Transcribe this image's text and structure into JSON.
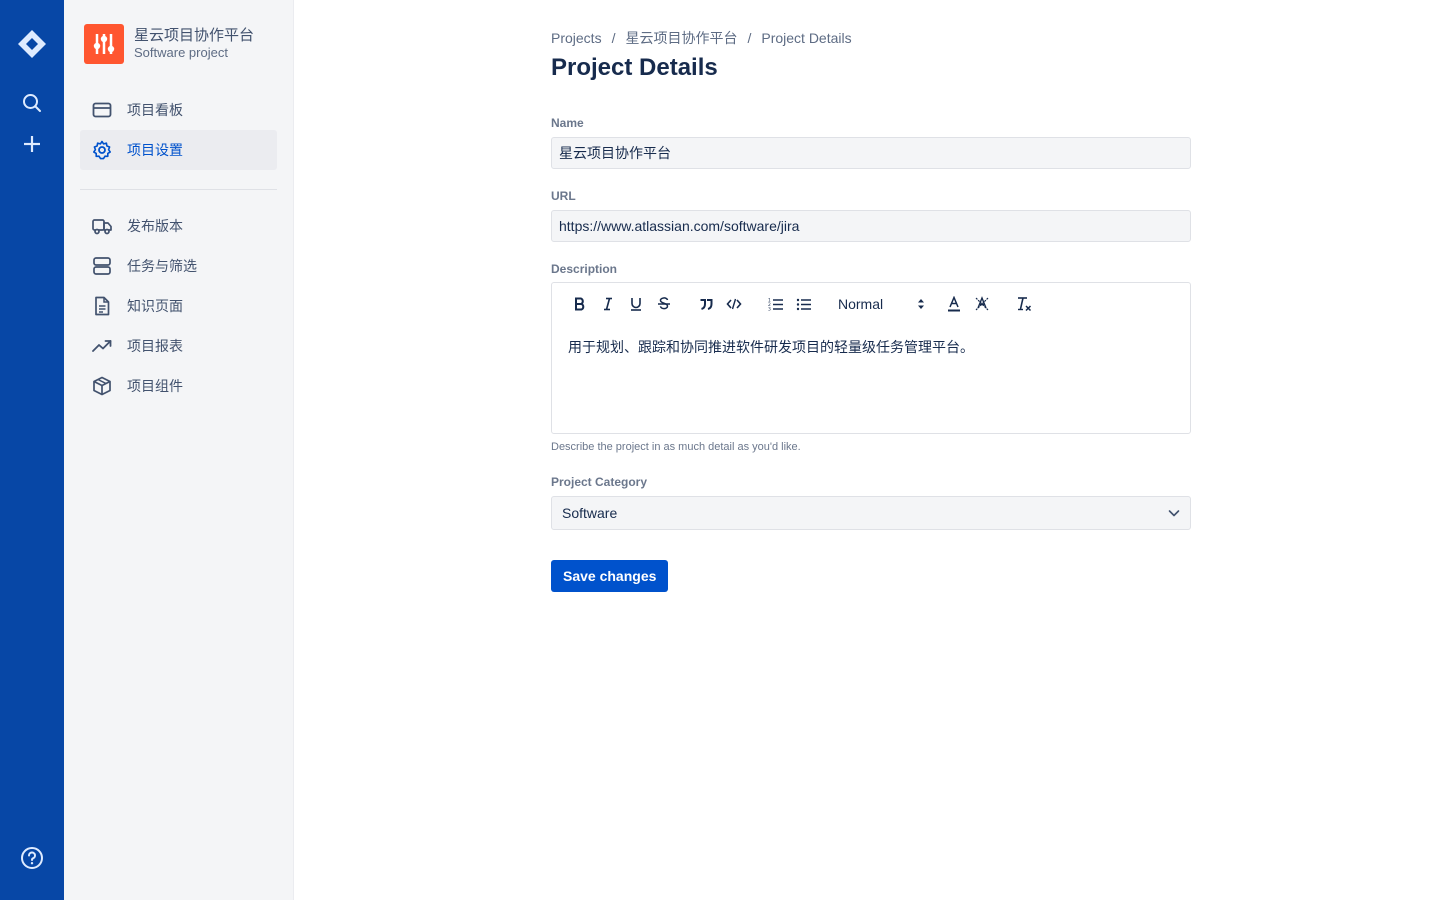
{
  "rail": {
    "icons": [
      "jira-logo-icon",
      "search-icon",
      "plus-icon",
      "help-icon"
    ],
    "color": "#0747a6"
  },
  "project": {
    "name": "星云项目协作平台",
    "type": "Software project",
    "avatar_color": "#ff5630"
  },
  "sidebar": {
    "primary": [
      {
        "label": "项目看板",
        "icon": "board-icon",
        "active": false
      },
      {
        "label": "项目设置",
        "icon": "gear-icon",
        "active": true
      }
    ],
    "secondary": [
      {
        "label": "发布版本",
        "icon": "truck-icon"
      },
      {
        "label": "任务与筛选",
        "icon": "server-icon"
      },
      {
        "label": "知识页面",
        "icon": "document-icon"
      },
      {
        "label": "项目报表",
        "icon": "trending-icon"
      },
      {
        "label": "项目组件",
        "icon": "package-icon"
      }
    ]
  },
  "breadcrumbs": [
    "Projects",
    "星云项目协作平台",
    "Project Details"
  ],
  "page": {
    "title": "Project Details"
  },
  "form": {
    "name_label": "Name",
    "name_value": "星云项目协作平台",
    "url_label": "URL",
    "url_value": "https://www.atlassian.com/software/jira",
    "description_label": "Description",
    "description_text": "用于规划、跟踪和协同推进软件研发项目的轻量级任务管理平台。",
    "description_help": "Describe the project in as much detail as you'd like.",
    "text_style": "Normal",
    "category_label": "Project Category",
    "category_value": "Software",
    "save_label": "Save changes"
  },
  "colors": {
    "accent": "#0052cc",
    "field_bg": "#f4f5f7"
  }
}
